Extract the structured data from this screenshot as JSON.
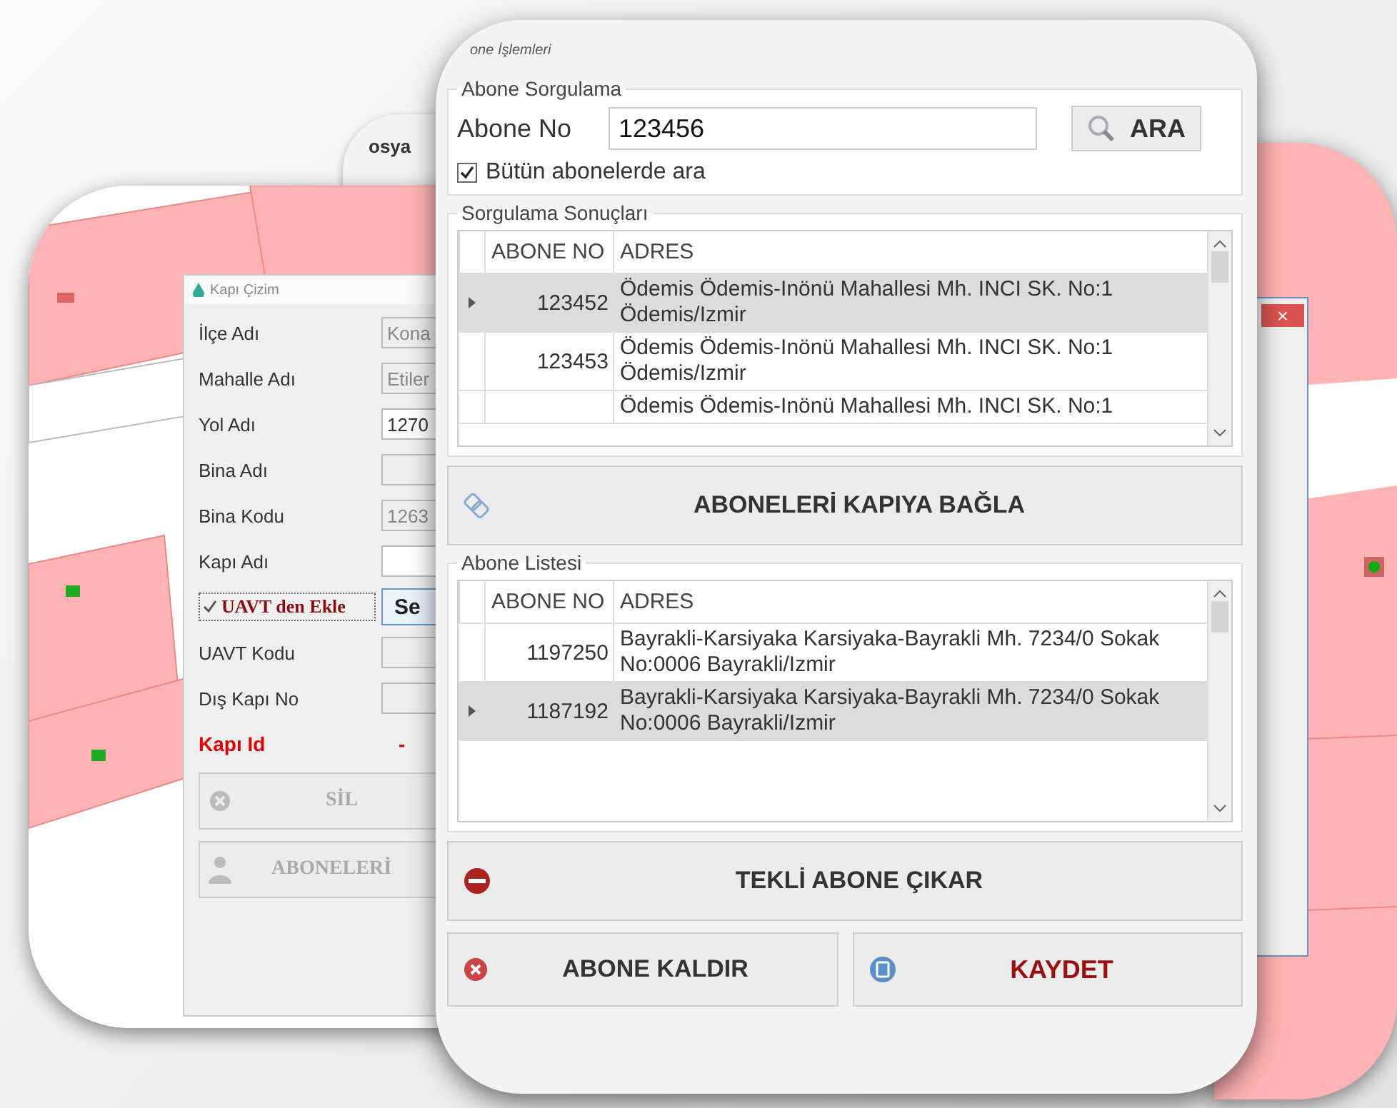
{
  "back_window": {
    "menu_fragment": "osya"
  },
  "kapi_cizim": {
    "title": "Kapı Çizim",
    "fields": [
      {
        "label": "İlçe Adı",
        "value": "Kona",
        "disabled": true
      },
      {
        "label": "Mahalle Adı",
        "value": "Etiler",
        "disabled": true
      },
      {
        "label": "Yol Adı",
        "value": "1270",
        "disabled": false
      },
      {
        "label": "Bina Adı",
        "disabled": true
      },
      {
        "label": "Bina Kodu",
        "value": "1263",
        "disabled": true
      },
      {
        "label": "Kapı Adı",
        "disabled": false
      }
    ],
    "uavt": {
      "label": "UAVT den Ekle",
      "checked": true,
      "button": "Se"
    },
    "fields2": [
      {
        "label": "UAVT Kodu",
        "disabled": true
      },
      {
        "label": "Dış Kapı No",
        "disabled": true
      }
    ],
    "kapi_id": {
      "label": "Kapı Id",
      "value": "-"
    },
    "sil_button": {
      "label": "SİL",
      "disabled": true
    },
    "aboneleri_button": {
      "label": "ABONELERİ",
      "disabled": true
    }
  },
  "main": {
    "title": "one İşlemleri",
    "search": {
      "legend": "Abone Sorgulama",
      "label": "Abone No",
      "value": "123456",
      "button": "ARA",
      "all_checkbox": {
        "label": "Bütün abonelerde ara",
        "checked": true
      }
    },
    "results": {
      "legend": "Sorgulama Sonuçları",
      "columns": [
        "ABONE NO",
        "ADRES"
      ],
      "rows": [
        {
          "abone_no": "123452",
          "adres": "Ödemis Ödemis-Inönü Mahallesi Mh. INCI SK. No:1 Ödemis/Izmir",
          "selected": true
        },
        {
          "abone_no": "123453",
          "adres": "Ödemis Ödemis-Inönü Mahallesi Mh. INCI SK. No:1 Ödemis/Izmir",
          "selected": false
        },
        {
          "adres": "Ödemis Ödemis-Inönü Mahallesi Mh. INCI SK. No:1",
          "selected": false
        }
      ]
    },
    "link_button": "ABONELERİ KAPIYA BAĞLA",
    "list": {
      "legend": "Abone Listesi",
      "columns": [
        "ABONE NO",
        "ADRES"
      ],
      "rows": [
        {
          "abone_no": "1197250",
          "adres": "Bayrakli-Karsiyaka Karsiyaka-Bayrakli Mh. 7234/0 Sokak No:0006 Bayrakli/Izmir",
          "selected": false
        },
        {
          "abone_no": "1187192",
          "adres": "Bayrakli-Karsiyaka Karsiyaka-Bayrakli Mh. 7234/0 Sokak No:0006 Bayrakli/Izmir",
          "selected": true
        }
      ]
    },
    "remove_one_button": "TEKLİ ABONE ÇIKAR",
    "remove_button": "ABONE KALDIR",
    "save_button": "KAYDET"
  },
  "right_window": {
    "close": "×"
  }
}
